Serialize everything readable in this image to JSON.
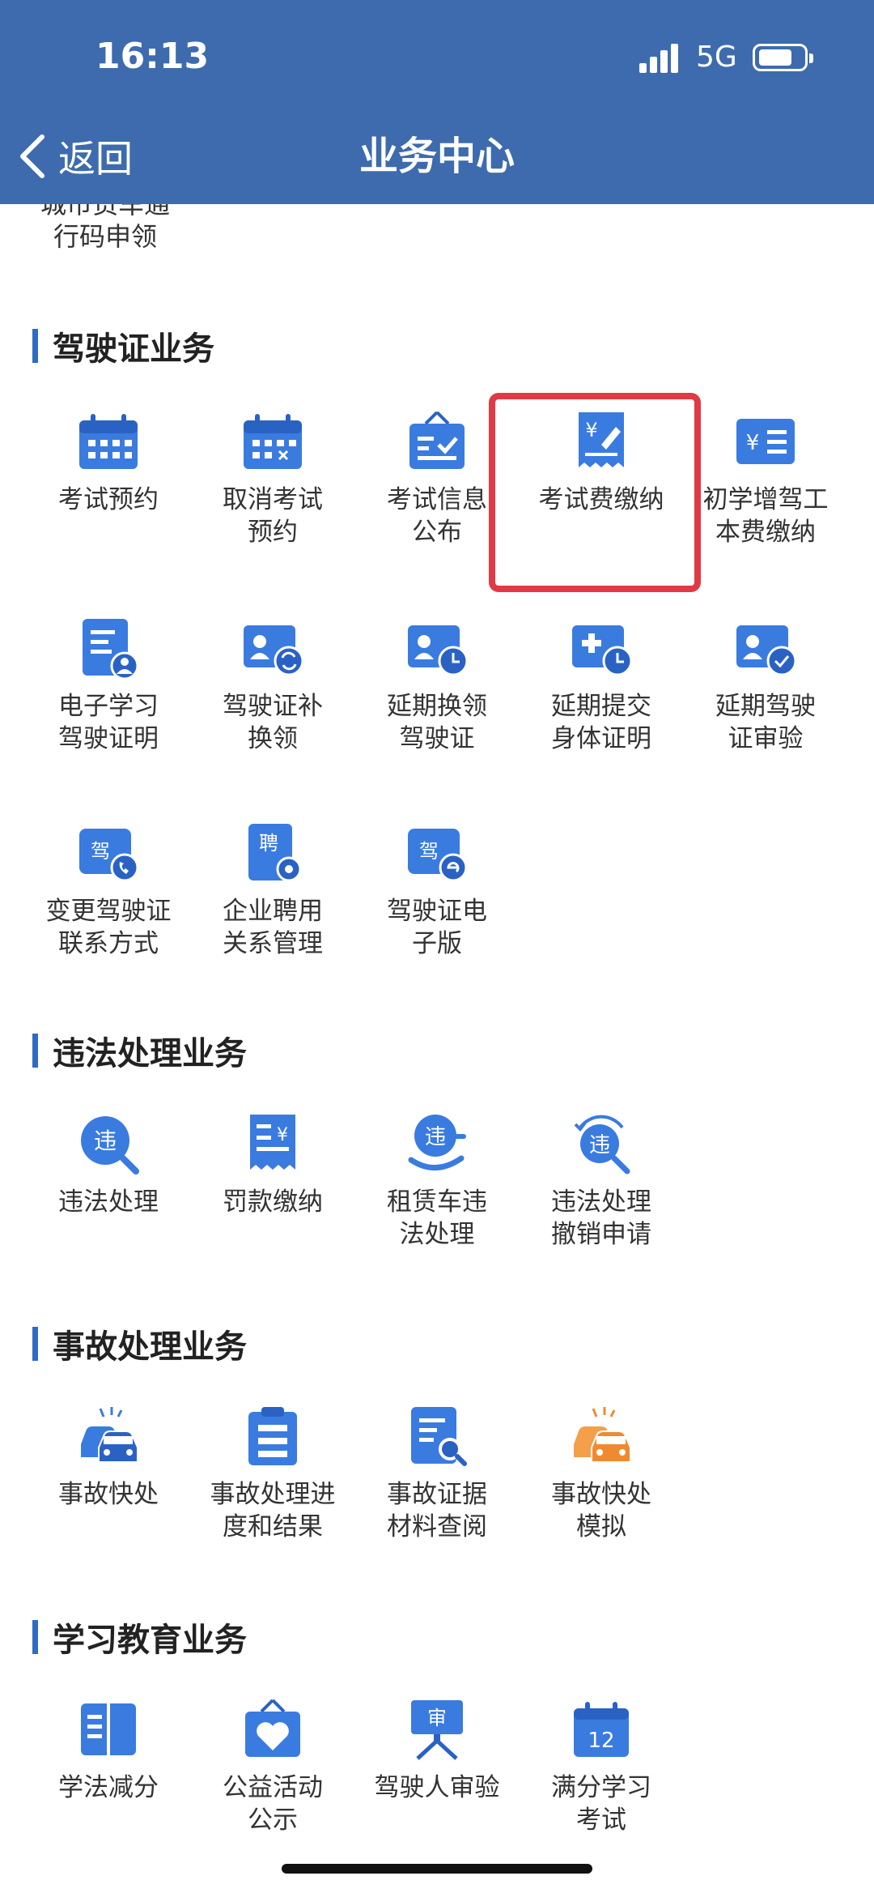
{
  "status": {
    "time": "16:13",
    "network": "5G"
  },
  "nav": {
    "back_label": "返回",
    "title": "业务中心"
  },
  "top_partial": {
    "line1": "城市货车通",
    "line2": "行码申领"
  },
  "sections": {
    "license": {
      "title": "驾驶证业务",
      "items": [
        {
          "line1": "考试预约",
          "line2": ""
        },
        {
          "line1": "取消考试",
          "line2": "预约"
        },
        {
          "line1": "考试信息",
          "line2": "公布"
        },
        {
          "line1": "考试费缴纳",
          "line2": ""
        },
        {
          "line1": "初学增驾工",
          "line2": "本费缴纳"
        },
        {
          "line1": "电子学习",
          "line2": "驾驶证明"
        },
        {
          "line1": "驾驶证补",
          "line2": "换领"
        },
        {
          "line1": "延期换领",
          "line2": "驾驶证"
        },
        {
          "line1": "延期提交",
          "line2": "身体证明"
        },
        {
          "line1": "延期驾驶",
          "line2": "证审验"
        },
        {
          "line1": "变更驾驶证",
          "line2": "联系方式"
        },
        {
          "line1": "企业聘用",
          "line2": "关系管理"
        },
        {
          "line1": "驾驶证电",
          "line2": "子版"
        }
      ]
    },
    "violation": {
      "title": "违法处理业务",
      "items": [
        {
          "line1": "违法处理",
          "line2": ""
        },
        {
          "line1": "罚款缴纳",
          "line2": ""
        },
        {
          "line1": "租赁车违",
          "line2": "法处理"
        },
        {
          "line1": "违法处理",
          "line2": "撤销申请"
        }
      ]
    },
    "accident": {
      "title": "事故处理业务",
      "items": [
        {
          "line1": "事故快处",
          "line2": ""
        },
        {
          "line1": "事故处理进",
          "line2": "度和结果"
        },
        {
          "line1": "事故证据",
          "line2": "材料查阅"
        },
        {
          "line1": "事故快处",
          "line2": "模拟"
        }
      ]
    },
    "education": {
      "title": "学习教育业务",
      "items": [
        {
          "line1": "学法减分",
          "line2": ""
        },
        {
          "line1": "公益活动",
          "line2": "公示"
        },
        {
          "line1": "驾驶人审验",
          "line2": ""
        },
        {
          "line1": "满分学习",
          "line2": "考试"
        }
      ]
    }
  },
  "icon_glyphs": {
    "yen": "¥",
    "pin": "聘",
    "jia": "驾",
    "wei": "违",
    "shen": "审",
    "num12": "12"
  },
  "colors": {
    "header": "#3d6bae",
    "icon_blue": "#3a7be0",
    "accent_orange": "#f08a30",
    "highlight": "#e03a45"
  }
}
